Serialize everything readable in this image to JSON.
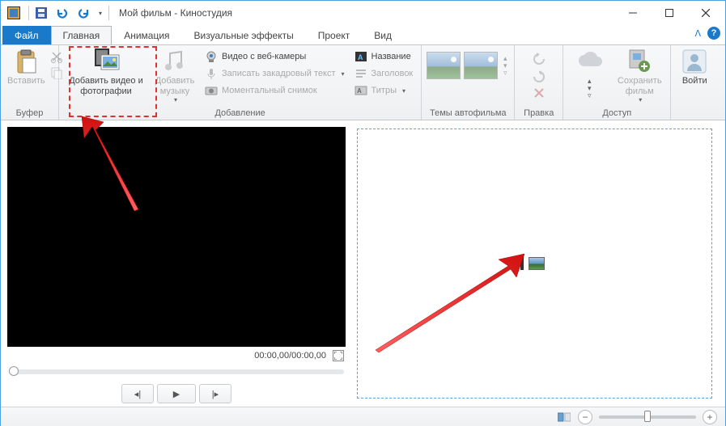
{
  "window": {
    "title": "Мой фильм - Киностудия"
  },
  "tabs": {
    "file": "Файл",
    "home": "Главная",
    "animation": "Анимация",
    "vfx": "Визуальные эффекты",
    "project": "Проект",
    "view": "Вид"
  },
  "ribbon": {
    "clipboard": {
      "paste": "Вставить",
      "group": "Буфер"
    },
    "add": {
      "add_media": "Добавить видео и фотографии",
      "add_music": "Добавить музыку",
      "webcam": "Видео с веб-камеры",
      "voiceover": "Записать закадровый текст",
      "snapshot": "Моментальный снимок",
      "title": "Название",
      "heading": "Заголовок",
      "captions": "Титры",
      "group": "Добавление"
    },
    "autofilm": {
      "group": "Темы автофильма"
    },
    "edit": {
      "group": "Правка"
    },
    "share": {
      "save": "Сохранить фильм",
      "group": "Доступ"
    },
    "signin": "Войти"
  },
  "player": {
    "time": "00:00,00/00:00,00"
  },
  "timeline": {
    "hint": ""
  },
  "colors": {
    "accent": "#1979ca",
    "highlight": "#e03030"
  }
}
